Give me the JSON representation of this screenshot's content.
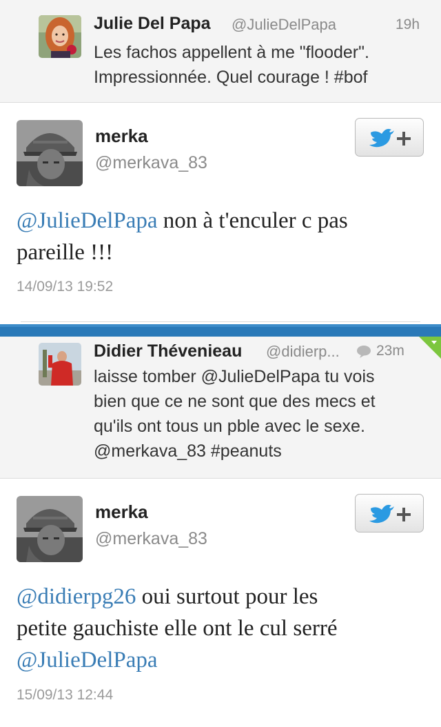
{
  "reply1": {
    "name": "Julie Del Papa",
    "handle": "@JulieDelPapa",
    "time": "19h",
    "line1": "Les fachos appellent à me \"flooder\".",
    "line2": "Impressionnée. Quel courage ! #bof"
  },
  "tweet1": {
    "name": "merka",
    "handle": "@merkava_83",
    "mention": "@JulieDelPapa",
    "rest_line1": " non à t'enculer c pas",
    "line2": "pareille !!!",
    "date": "14/09/13 19:52"
  },
  "reply2": {
    "name": "Didier Thévenieau",
    "handle": "@didierp...",
    "time": "23m",
    "line1": "laisse tomber @JulieDelPapa tu vois",
    "line2": "bien que ce ne sont que des mecs et",
    "line3": "qu'ils ont tous un pble avec le sexe.",
    "line4": "@merkava_83 #peanuts"
  },
  "tweet2": {
    "name": "merka",
    "handle": "@merkava_83",
    "mention1": "@didierpg26",
    "rest_line1": " oui surtout pour les",
    "line2": "petite gauchiste elle ont le cul serré",
    "mention2": "@JulieDelPapa",
    "date": "15/09/13 12:44"
  },
  "colors": {
    "mention": "#3a7db5",
    "twitter_bird": "#2b9ae2",
    "divider_blue": "#2a79b8",
    "marker_green": "#7cc63e"
  }
}
